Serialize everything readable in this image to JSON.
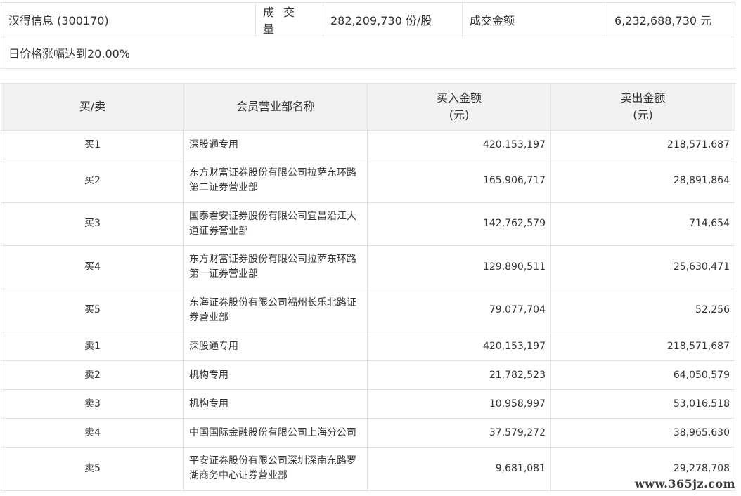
{
  "summary": {
    "stock": "汉得信息 (300170)",
    "volume_label": "成 交 量",
    "volume_value": "282,209,730 份/股",
    "amount_label": "成交金额",
    "amount_value": "6,232,688,730 元",
    "note": "日价格涨幅达到20.00%"
  },
  "table": {
    "headers": {
      "side": "买/卖",
      "name": "会员营业部名称",
      "buy_line1": "买入金额",
      "buy_line2": "(元)",
      "sell_line1": "卖出金额",
      "sell_line2": "(元)"
    },
    "rows": [
      {
        "side": "买1",
        "name": "深股通专用",
        "buy": "420,153,197",
        "sell": "218,571,687"
      },
      {
        "side": "买2",
        "name": "东方财富证券股份有限公司拉萨东环路第二证券营业部",
        "buy": "165,906,717",
        "sell": "28,891,864"
      },
      {
        "side": "买3",
        "name": "国泰君安证券股份有限公司宜昌沿江大道证券营业部",
        "buy": "142,762,579",
        "sell": "714,654"
      },
      {
        "side": "买4",
        "name": "东方财富证券股份有限公司拉萨东环路第一证券营业部",
        "buy": "129,890,511",
        "sell": "25,630,471"
      },
      {
        "side": "买5",
        "name": "东海证券股份有限公司福州长乐北路证券营业部",
        "buy": "79,077,704",
        "sell": "52,256"
      },
      {
        "side": "卖1",
        "name": "深股通专用",
        "buy": "420,153,197",
        "sell": "218,571,687"
      },
      {
        "side": "卖2",
        "name": "机构专用",
        "buy": "21,782,523",
        "sell": "64,050,579"
      },
      {
        "side": "卖3",
        "name": "机构专用",
        "buy": "10,958,997",
        "sell": "53,016,518"
      },
      {
        "side": "卖4",
        "name": "中国国际金融股份有限公司上海分公司",
        "buy": "37,579,272",
        "sell": "38,965,630"
      },
      {
        "side": "卖5",
        "name": "平安证券股份有限公司深圳深南东路罗湖商务中心证券营业部",
        "buy": "9,681,081",
        "sell": "29,278,708"
      }
    ]
  },
  "watermark": "www.365jz.com"
}
